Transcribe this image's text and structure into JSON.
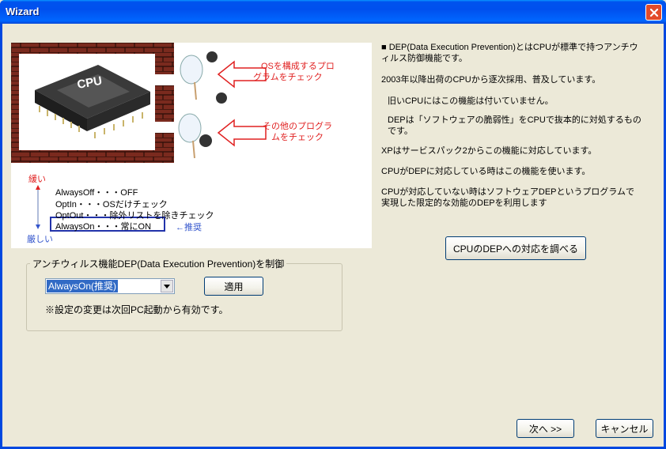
{
  "window": {
    "title": "Wizard",
    "close_icon": "close-icon"
  },
  "illustration": {
    "chip_label": "CPU",
    "callout_os_line1": "OSを構成するプロ",
    "callout_os_line2": "グラムをチェック",
    "callout_other_line1": "その他のプログラ",
    "callout_other_line2": "ムをチェック",
    "scale_top": "緩い",
    "scale_bottom": "厳しい",
    "modes": [
      "AlwaysOff・・・OFF",
      "OptIn・・・OSだけチェック",
      "OptOut・・・除外リストを除きチェック",
      "AlwaysOn・・・常にON"
    ],
    "recommended": "←推奨",
    "colors": {
      "red": "#e02020",
      "blue": "#3355cc",
      "brick": "#7a2a1e"
    }
  },
  "control_group": {
    "label": "アンチウィルス機能DEP(Data Execution Prevention)を制御",
    "select_value": "AlwaysOn(推奨)",
    "apply_label": "適用",
    "note": "※設定の変更は次回PC起動から有効です。"
  },
  "description": {
    "p1": "■ DEP(Data Execution Prevention)とはCPUが標準で持つアンチウィルス防御機能です。",
    "p2": "2003年以降出荷のCPUから逐次採用、普及しています。",
    "p3": "旧いCPUにはこの機能は付いていません。",
    "p4": "DEPは「ソフトウェアの脆弱性」をCPUで抜本的に対処するものです。",
    "p5": "XPはサービスパック2からこの機能に対応しています。",
    "p6": "CPUがDEPに対応している時はこの機能を使います。",
    "p7": "CPUが対応していない時はソフトウェアDEPというプログラムで実現した限定的な効能のDEPを利用します"
  },
  "buttons": {
    "check_cpu": "CPUのDEPへの対応を調べる",
    "next": "次へ >>",
    "cancel": "キャンセル"
  }
}
